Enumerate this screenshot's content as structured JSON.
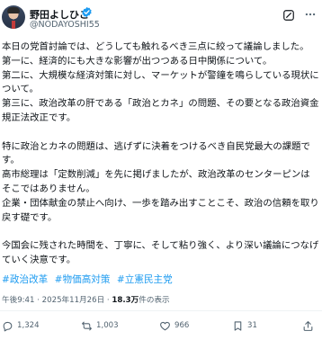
{
  "author": {
    "name": "野田よしひこ",
    "handle": "@NODAYOSHI55"
  },
  "post": {
    "paragraphs": [
      "本日の党首討論では、どうしても触れるべき三点に絞って議論しました。",
      "第一に、経済的にも大きな影響が出つつある日中関係について。",
      "第二に、大規模な経済対策に対し、マーケットが警鐘を鳴らしている現状について。",
      "第三に、政治改革の肝である「政治とカネ」の問題、その要となる政治資金規正法改正です。",
      "",
      "特に政治とカネの問題は、逃げずに決着をつけるべき自民党最大の課題です。",
      "高市総理は「定数削減」を先に掲げましたが、政治改革のセンターピンはそこではありません。",
      "企業・団体献金の禁止へ向け、一歩を踏み出すことこそ、政治の信頼を取り戻す礎です。",
      "",
      "今国会に残された時間を、丁寧に、そして粘り強く、より深い議論につなげていく決意です。"
    ],
    "hashtags": [
      "#政治改革",
      "#物価高対策",
      "#立憲民主党"
    ],
    "time": "午後9:41 · 2025年11月26日 · ",
    "views": "18.3万",
    "views_label": "件の表示"
  },
  "actions": {
    "replies": "1,324",
    "reposts": "1,003",
    "likes": "966",
    "bookmarks": "31"
  },
  "icons": {
    "verified": "verified-badge-icon",
    "grok": "grok-icon",
    "more": "more-icon",
    "reply": "reply-icon",
    "repost": "repost-icon",
    "like": "like-icon",
    "bookmark": "bookmark-icon",
    "share": "share-icon"
  },
  "colors": {
    "accent": "#1d9bf0",
    "text": "#0f1419",
    "muted": "#536471"
  }
}
